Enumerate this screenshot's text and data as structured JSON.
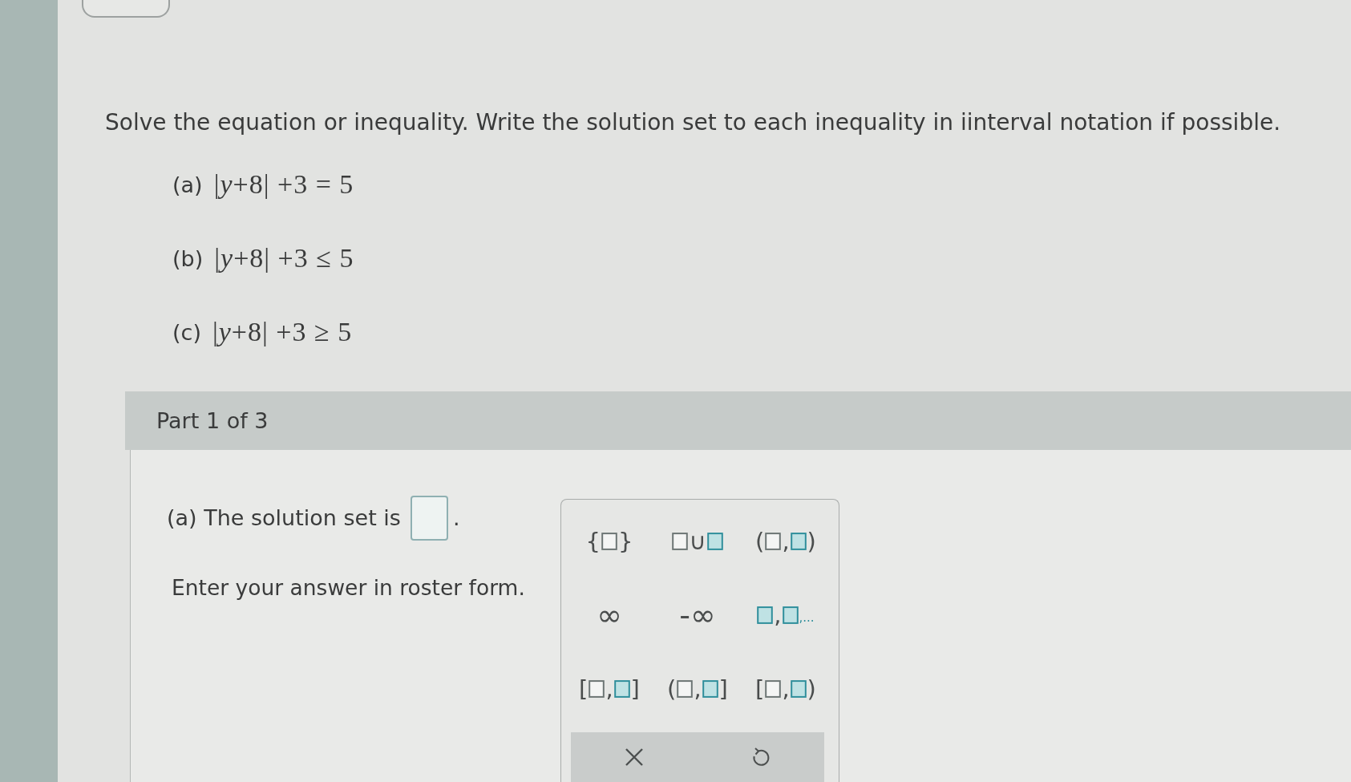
{
  "instructions": "Solve the equation or inequality. Write the solution set to each inequality in iinterval notation if possible.",
  "problems": [
    {
      "label": "(a)",
      "expression": "|*y*+8| +3 = 5"
    },
    {
      "label": "(b)",
      "expression": "|*y*+8| +3 ≤ 5"
    },
    {
      "label": "(c)",
      "expression": "|*y*+8| +3 ≥ 5"
    }
  ],
  "part_header": "Part 1 of 3",
  "answer": {
    "prompt": "(a) The solution set is",
    "after": ".",
    "hint": "Enter your answer in roster form."
  },
  "keypad": {
    "keys": [
      {
        "kind": "template",
        "parts": [
          {
            "kind": "text",
            "text": "{"
          },
          {
            "kind": "slot",
            "filled": false
          },
          {
            "kind": "text",
            "text": "}"
          }
        ]
      },
      {
        "kind": "template",
        "parts": [
          {
            "kind": "slot",
            "filled": false
          },
          {
            "kind": "text",
            "text": "∪"
          },
          {
            "kind": "slot",
            "filled": true
          }
        ]
      },
      {
        "kind": "template",
        "parts": [
          {
            "kind": "text",
            "text": "("
          },
          {
            "kind": "slot",
            "filled": false
          },
          {
            "kind": "text",
            "text": ","
          },
          {
            "kind": "slot",
            "filled": true
          },
          {
            "kind": "text",
            "text": ")"
          }
        ]
      },
      {
        "kind": "symbol",
        "parts": [
          {
            "kind": "text",
            "text": "∞"
          }
        ]
      },
      {
        "kind": "symbol",
        "parts": [
          {
            "kind": "text",
            "text": "-∞"
          }
        ]
      },
      {
        "kind": "template",
        "parts": [
          {
            "kind": "slot",
            "filled": true
          },
          {
            "kind": "text",
            "text": ","
          },
          {
            "kind": "slot",
            "filled": true
          },
          {
            "kind": "small",
            "text": ",..."
          }
        ]
      },
      {
        "kind": "template",
        "parts": [
          {
            "kind": "text",
            "text": "["
          },
          {
            "kind": "slot",
            "filled": false
          },
          {
            "kind": "text",
            "text": ","
          },
          {
            "kind": "slot",
            "filled": true
          },
          {
            "kind": "text",
            "text": "]"
          }
        ]
      },
      {
        "kind": "template",
        "parts": [
          {
            "kind": "text",
            "text": "("
          },
          {
            "kind": "slot",
            "filled": false
          },
          {
            "kind": "text",
            "text": ","
          },
          {
            "kind": "slot",
            "filled": true
          },
          {
            "kind": "text",
            "text": "]"
          }
        ]
      },
      {
        "kind": "template",
        "parts": [
          {
            "kind": "text",
            "text": "["
          },
          {
            "kind": "slot",
            "filled": false
          },
          {
            "kind": "text",
            "text": ","
          },
          {
            "kind": "slot",
            "filled": true
          },
          {
            "kind": "text",
            "text": ")"
          }
        ]
      }
    ],
    "actions": [
      {
        "kind": "clear"
      },
      {
        "kind": "undo"
      }
    ]
  }
}
